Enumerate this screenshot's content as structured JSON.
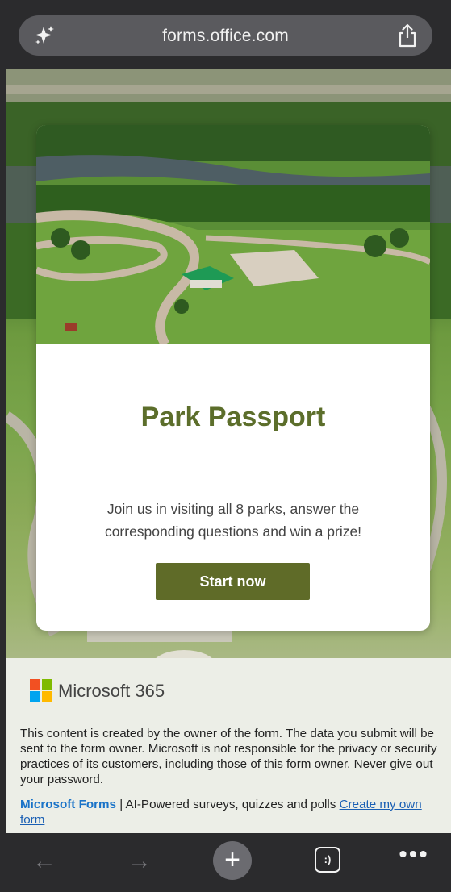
{
  "browser": {
    "url": "forms.office.com",
    "icons": {
      "left": "sparkle-icon",
      "right": "share-icon"
    }
  },
  "form": {
    "title": "Park Passport",
    "description": "Join us in visiting all 8 parks, answer the corresponding questions and win a prize!",
    "start_label": "Start now",
    "colors": {
      "title": "#5c6e2b",
      "button": "#5f6b28"
    }
  },
  "footer": {
    "brand": "Microsoft 365",
    "disclaimer": "This content is created by the owner of the form. The data you submit will be sent to the form owner. Microsoft is not responsible for the privacy or security practices of its customers, including those of this form owner. Never give out your password.",
    "forms_link": "Microsoft Forms",
    "tagline": " | AI-Powered surveys, quizzes and polls ",
    "create_link": "Create my own form"
  },
  "toolbar": {
    "back_icon": "←",
    "forward_icon": "→",
    "new_tab_icon": "+",
    "tabs_label": ":)",
    "more_icon": "•••"
  }
}
